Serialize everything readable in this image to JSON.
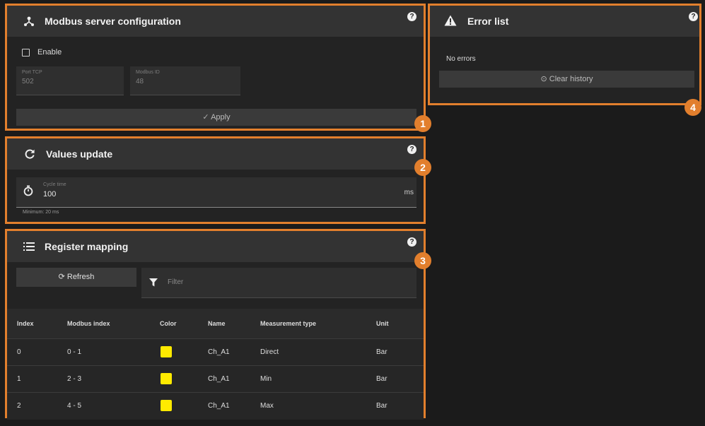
{
  "modbus": {
    "title": "Modbus server configuration",
    "enable_label": "Enable",
    "port_label": "Port TCP",
    "port_value": "502",
    "modbus_id_label": "Modbus ID",
    "modbus_id_value": "48",
    "apply_label": "Apply",
    "badge": "1"
  },
  "values_update": {
    "title": "Values update",
    "cycle_label": "Cycle time",
    "cycle_value": "100",
    "unit": "ms",
    "hint": "Minimum: 20 ms",
    "badge": "2"
  },
  "register_mapping": {
    "title": "Register mapping",
    "refresh_label": "Refresh",
    "filter_placeholder": "Filter",
    "badge": "3",
    "columns": [
      "Index",
      "Modbus index",
      "Color",
      "Name",
      "Measurement type",
      "Unit"
    ],
    "rows": [
      {
        "index": "0",
        "modbus_index": "0 - 1",
        "color": "#ffea00",
        "name": "Ch_A1",
        "type": "Direct",
        "unit": "Bar"
      },
      {
        "index": "1",
        "modbus_index": "2 - 3",
        "color": "#ffea00",
        "name": "Ch_A1",
        "type": "Min",
        "unit": "Bar"
      },
      {
        "index": "2",
        "modbus_index": "4 - 5",
        "color": "#ffea00",
        "name": "Ch_A1",
        "type": "Max",
        "unit": "Bar"
      }
    ]
  },
  "error_list": {
    "title": "Error list",
    "status": "No errors",
    "clear_label": "Clear history",
    "badge": "4"
  },
  "help_glyph": "?",
  "icons": {
    "modbus": "network-icon",
    "values": "refresh-icon",
    "timer": "stopwatch-icon",
    "mapping": "list-icon",
    "filter": "filter-icon",
    "error": "warning-icon",
    "clear": "history-icon"
  },
  "colors": {
    "accent": "#e27f2d",
    "background": "#1b1b1b",
    "header": "#333333",
    "swatch": "#ffea00"
  }
}
